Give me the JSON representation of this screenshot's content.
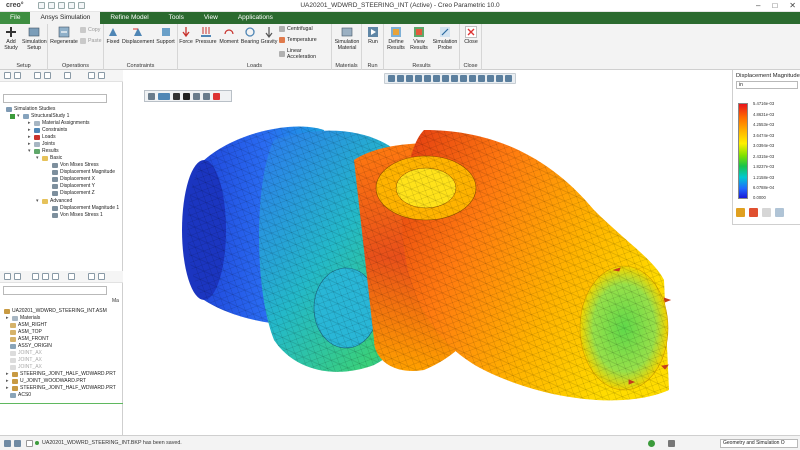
{
  "window": {
    "logo": "creo°",
    "title": "UA20201_WDWRD_STEERING_INT (Active) - Creo Parametric 10.0"
  },
  "tabs": [
    "File",
    "Ansys Simulation",
    "Refine Model",
    "Tools",
    "View",
    "Applications"
  ],
  "active_tab": "Ansys Simulation",
  "ribbon": {
    "setup": {
      "label": "Setup",
      "buttons": [
        "Add Study",
        "Simulation Setup"
      ]
    },
    "operations": {
      "label": "Operations",
      "buttons": [
        "Regenerate"
      ],
      "small": [
        "Copy",
        "Paste"
      ]
    },
    "constraints": {
      "label": "Constraints",
      "buttons": [
        "Fixed",
        "Displacement",
        "Support"
      ]
    },
    "loads": {
      "label": "Loads",
      "buttons": [
        "Force",
        "Pressure",
        "Moment",
        "Bearing",
        "Gravity"
      ],
      "small": [
        "Centrifugal",
        "Temperature",
        "Linear Acceleration"
      ]
    },
    "materials": {
      "label": "Materials",
      "buttons": [
        "Simulation Material"
      ]
    },
    "run": {
      "label": "Run",
      "buttons": [
        "Run"
      ]
    },
    "results": {
      "label": "Results",
      "buttons": [
        "Define Results",
        "View Results",
        "Simulation Probe"
      ]
    },
    "close": {
      "label": "Close",
      "buttons": [
        "Close"
      ]
    }
  },
  "sim_tree": {
    "items": [
      "Simulation Studies",
      "StructuralStudy 1",
      "Material Assignments",
      "Constraints",
      "Loads",
      "Joints",
      "Results",
      "Basic",
      "Von Mises Stress",
      "Displacement Magnitude",
      "Displacement X",
      "Displacement Y",
      "Displacement Z",
      "Advanced",
      "Displacement Magnitude 1",
      "Von Mises Stress 1"
    ]
  },
  "model_tree": {
    "items": [
      "UA20201_WDWRD_STEERING_INT.ASM",
      "Materials",
      "ASM_RIGHT",
      "ASM_TOP",
      "ASM_FRONT",
      "ASSY_ORIGIN",
      "JOINT_AX",
      "JOINT_AX",
      "JOINT_AX",
      "STEERING_JOINT_HALF_WDWARD.PRT",
      "U_JOINT_WOODWARD.PRT",
      "STEERING_JOINT_HALF_WDWARD.PRT",
      "ACS0"
    ],
    "side_tag": "Ma"
  },
  "legend": {
    "title": "Displacement Magnitude",
    "unit": "in",
    "ticks": [
      "5.4716e-03",
      "4.8631e-03",
      "4.2553e-03",
      "3.6474e-03",
      "3.0394e-03",
      "2.4315e-03",
      "1.8237e-03",
      "1.2158e-03",
      "6.0788e-04",
      "0.0000"
    ]
  },
  "status": {
    "message": "UA20201_WDWRD_STEERING_INT.BKP has been saved.",
    "filter": "Geometry and Simulation O"
  },
  "colors": {
    "accent_green": "#2b6a2f",
    "file_tab": "#3e8e41"
  }
}
